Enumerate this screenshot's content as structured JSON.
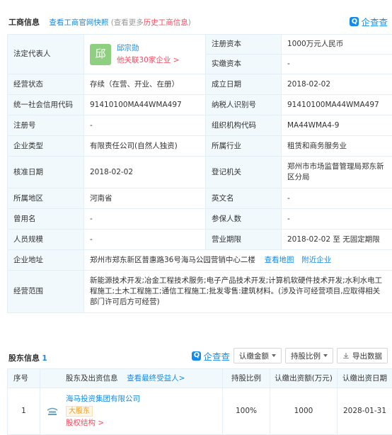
{
  "header": {
    "title": "工商信息",
    "official_snapshot": "查看工商官网快照",
    "history_prefix": "(查看更多",
    "history_link": "历史工商信息",
    "history_suffix": ")",
    "brand": "企查查"
  },
  "info": {
    "legal_rep_label": "法定代表人",
    "legal_rep_avatar": "邱",
    "legal_rep_name": "邱宗勋",
    "legal_rep_related": "他关联30家企业 >",
    "reg_capital_label": "注册资本",
    "reg_capital": "1000万元人民币",
    "paid_capital_label": "实缴资本",
    "paid_capital": "-",
    "status_label": "经营状态",
    "status": "存续（在营、开业、在册）",
    "established_label": "成立日期",
    "established": "2018-02-02",
    "credit_code_label": "统一社会信用代码",
    "credit_code": "91410100MA44WMA497",
    "taxpayer_id_label": "纳税人识别号",
    "taxpayer_id": "91410100MA44WMA497",
    "reg_no_label": "注册号",
    "reg_no": "-",
    "org_code_label": "组织机构代码",
    "org_code": "MA44WMA4-9",
    "company_type_label": "企业类型",
    "company_type": "有限责任公司(自然人独资)",
    "industry_label": "所属行业",
    "industry": "租赁和商务服务业",
    "approval_date_label": "核准日期",
    "approval_date": "2018-02-02",
    "authority_label": "登记机关",
    "authority": "郑州市市场监督管理局郑东新区分局",
    "region_label": "所属地区",
    "region": "河南省",
    "english_name_label": "英文名",
    "english_name": "-",
    "former_name_label": "曾用名",
    "former_name": "-",
    "insured_label": "参保人数",
    "insured": "-",
    "staff_size_label": "人员规模",
    "staff_size": "-",
    "term_label": "营业期限",
    "term": "2018-02-02 至 无固定期限",
    "address_label": "企业地址",
    "address": "郑州市郑东新区普惠路36号海马公园营销中心二楼",
    "view_map": "查看地图",
    "nearby": "附近企业",
    "scope_label": "经营范围",
    "scope": "新能源技术开发;冶金工程技术服务;电子产品技术开发;计算机软硬件技术开发;水利水电工程施工;土木工程施工;通信工程施工;批发零售:建筑材料。(涉及许可经营项目,应取得相关部门许可后方可经营)"
  },
  "shareholders": {
    "title": "股东信息",
    "count": "1",
    "brand": "企查查",
    "btn_amount": "认缴金额",
    "btn_ratio": "持股比例",
    "btn_export": "导出数据",
    "col_no": "序号",
    "col_name": "股东及出资信息",
    "col_beneficiary": "查看最终受益人>",
    "col_ratio": "持股比例",
    "col_amount": "认缴出资额(万元)",
    "col_date": "认缴出资日期",
    "rows": [
      {
        "no": "1",
        "name": "海马投资集团有限公司",
        "tag": "大股东",
        "equity": "股权结构 >",
        "ratio": "100%",
        "amount": "1000",
        "date": "2028-01-31"
      }
    ]
  },
  "colors": {
    "accent": "#128bed",
    "key_bg": "#f2f9fc",
    "border": "#e4eef6",
    "orange": "#fd485e",
    "tag": "#f99b1d"
  }
}
